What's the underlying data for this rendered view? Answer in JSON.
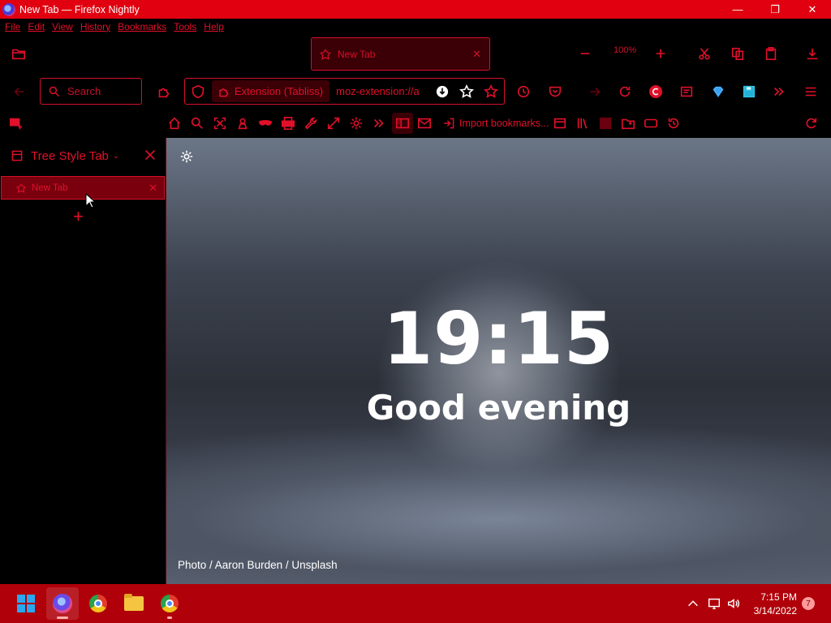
{
  "window": {
    "title": "New Tab — Firefox Nightly",
    "controls": [
      "—",
      "❐",
      "✕"
    ]
  },
  "menu": [
    "File",
    "Edit",
    "View",
    "History",
    "Bookmarks",
    "Tools",
    "Help"
  ],
  "tabstrip": {
    "active_tab": {
      "title": "New Tab",
      "close": "✕"
    },
    "zoom": "100%"
  },
  "navbar": {
    "search_placeholder": "Search",
    "identity_label": "Extension (Tabliss)",
    "url": "moz-extension://a"
  },
  "bookmarks_toolbar": {
    "import_label": "Import bookmarks..."
  },
  "sidebar": {
    "title": "Tree Style Tab",
    "chevron": "⌄",
    "tabs": [
      {
        "title": "New Tab",
        "close": "✕"
      }
    ],
    "new_tab": "+"
  },
  "newtab_page": {
    "time": "19:15",
    "greeting": "Good evening",
    "credit": "Photo / Aaron Burden / Unsplash"
  },
  "taskbar": {
    "time": "7:15 PM",
    "date": "3/14/2022",
    "notifications": "7"
  },
  "colors": {
    "accent": "#e0102a",
    "titlebar": "#e0000f",
    "taskbar": "#b00009",
    "background": "#000000"
  }
}
